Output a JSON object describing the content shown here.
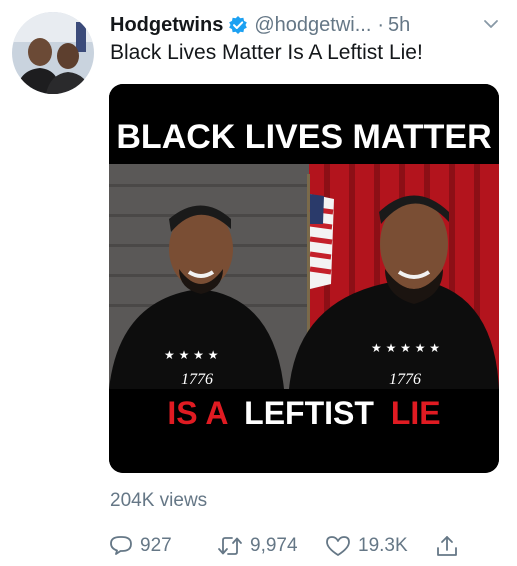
{
  "tweet": {
    "display_name": "Hodgetwins",
    "handle": "@hodgetwi...",
    "separator": "·",
    "time": "5h",
    "text": "Black Lives Matter Is A Leftist Lie!",
    "views": "204K views"
  },
  "media": {
    "caption_top": "BLACK LIVES MATTER",
    "caption_bottom_red1": "IS A",
    "caption_bottom_white": "LEFTIST",
    "caption_bottom_red2": "LIE",
    "shirt_text_left": "1776",
    "shirt_text_right": "1776"
  },
  "actions": {
    "replies": "927",
    "retweets": "9,974",
    "likes": "19.3K"
  },
  "colors": {
    "verified": "#1da1f2",
    "secondary_text": "#657786",
    "caption_red": "#e01b22"
  },
  "icons": {
    "verified": "verified-badge-icon",
    "chevron": "chevron-down-icon",
    "reply": "reply-icon",
    "retweet": "retweet-icon",
    "like": "heart-icon",
    "share": "share-icon"
  }
}
